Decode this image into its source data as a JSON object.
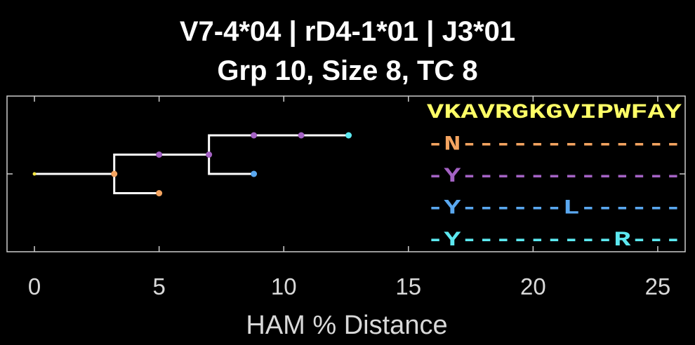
{
  "chart_data": {
    "type": "tree",
    "title_line1": "V7-4*04 | rD4-1*01 | J3*01",
    "title_line2": "Grp 10, Size 8, TC 8",
    "xlabel": "HAM % Distance",
    "xlim": [
      -1.1,
      26.1
    ],
    "xticks": [
      0,
      5,
      10,
      15,
      20,
      25
    ],
    "xtick_labels": [
      "0",
      "5",
      "10",
      "15",
      "20",
      "25"
    ],
    "grid": false,
    "nodes": [
      {
        "id": "root",
        "x": 0.0,
        "row": 0,
        "color": "#f5e642"
      },
      {
        "id": "n1",
        "x": 3.2,
        "row": 0,
        "color": "#f4a460"
      },
      {
        "id": "n2",
        "x": 5.0,
        "row": 1,
        "color": "#f4a460"
      },
      {
        "id": "n3",
        "x": 5.0,
        "row": -1,
        "color": "#a462c4"
      },
      {
        "id": "n4",
        "x": 7.0,
        "row": -1,
        "color": "#a462c4"
      },
      {
        "id": "n5",
        "x": 8.8,
        "row": -2,
        "color": "#a462c4"
      },
      {
        "id": "n6",
        "x": 10.7,
        "row": -2,
        "color": "#a462c4"
      },
      {
        "id": "n7",
        "x": 12.6,
        "row": -2,
        "color": "#5ce8f0"
      },
      {
        "id": "n8",
        "x": 8.8,
        "row": 0,
        "color": "#5aa8f0"
      }
    ],
    "edges": [
      [
        "root",
        "n1"
      ],
      [
        "n1",
        "n2"
      ],
      [
        "n1",
        "n3"
      ],
      [
        "n3",
        "n4"
      ],
      [
        "n4",
        "n5"
      ],
      [
        "n5",
        "n6"
      ],
      [
        "n6",
        "n7"
      ],
      [
        "n4",
        "n8"
      ]
    ],
    "sequences": [
      {
        "text": "VKAVRGKGVIPWFAY",
        "color": "#ffff66"
      },
      {
        "text": "-N-------------",
        "color": "#f4a460"
      },
      {
        "text": "-Y-------------",
        "color": "#a462c4"
      },
      {
        "text": "-Y------L------",
        "color": "#5aa8f0"
      },
      {
        "text": "-Y---------R---",
        "color": "#5ce8f0"
      }
    ]
  }
}
